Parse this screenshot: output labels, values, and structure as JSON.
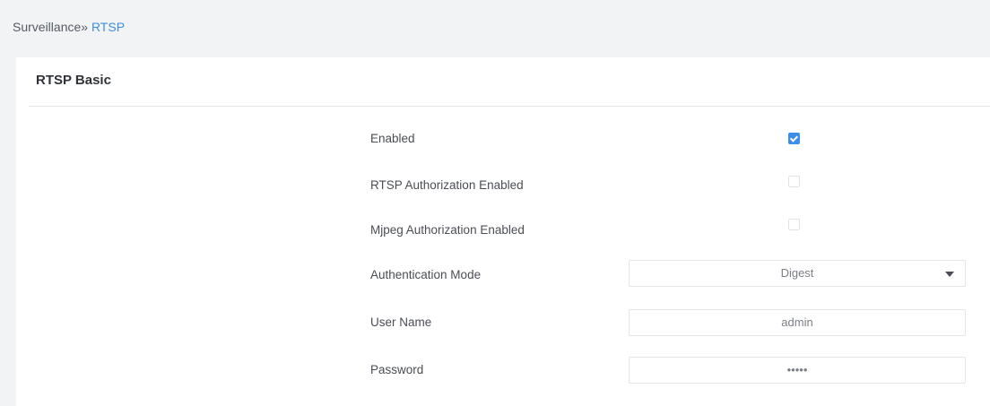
{
  "breadcrumb": {
    "parent": "Surveillance",
    "separator": "»",
    "current": "RTSP"
  },
  "section": {
    "title": "RTSP Basic"
  },
  "settings": {
    "enabled": {
      "label": "Enabled",
      "checked": true
    },
    "rtsp_auth": {
      "label": "RTSP Authorization Enabled",
      "checked": false
    },
    "mjpeg_auth": {
      "label": "Mjpeg Authorization Enabled",
      "checked": false
    },
    "auth_mode": {
      "label": "Authentication Mode",
      "value": "Digest"
    },
    "username": {
      "label": "User Name",
      "value": "admin"
    },
    "password": {
      "label": "Password",
      "value": "•••••"
    }
  },
  "icons": {
    "dropdown": "chevron-down-icon"
  },
  "colors": {
    "accent": "#3b8eea",
    "link": "#3c8fe0",
    "background": "#f2f3f5"
  }
}
